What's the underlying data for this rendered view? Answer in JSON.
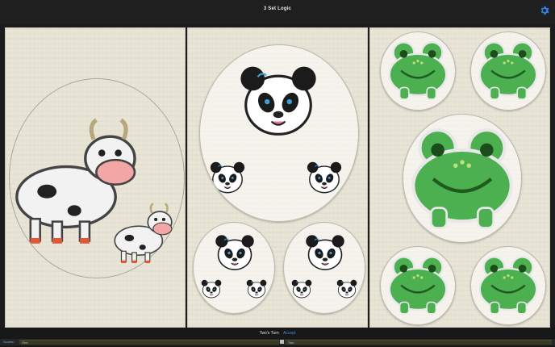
{
  "app": {
    "title": "3 Set Logic"
  },
  "header": {
    "settings_icon": "gear-icon",
    "accent": "#2f7fe0"
  },
  "cards": [
    {
      "animal": "cow",
      "items": [
        {
          "animal": "cow",
          "size": "large"
        },
        {
          "animal": "cow",
          "size": "small"
        }
      ]
    },
    {
      "animal": "panda",
      "items": [
        {
          "animal": "panda",
          "size": "large"
        },
        {
          "animal": "panda",
          "size": "medium"
        },
        {
          "animal": "panda",
          "size": "medium"
        }
      ]
    },
    {
      "animal": "frog",
      "items": [
        {
          "animal": "frog",
          "size": "large"
        },
        {
          "animal": "frog",
          "size": "small",
          "count": 4
        }
      ]
    }
  ],
  "footer": {
    "turn_text": "Two's Turn",
    "accept_label": "Accept",
    "scores_label": "Scores:",
    "player1": "One",
    "player2": "Two"
  },
  "colors": {
    "card_bg": "#e9e5d6",
    "frog_green": "#4caf50",
    "accept_blue": "#4a86e8"
  }
}
